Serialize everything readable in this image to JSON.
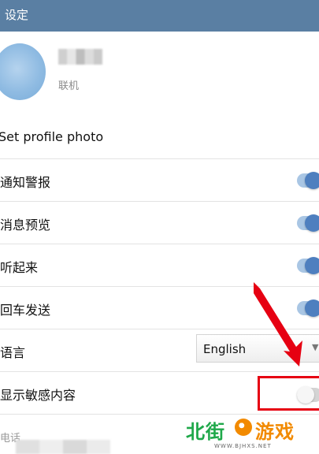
{
  "header": {
    "title": "设定"
  },
  "profile": {
    "status": "联机"
  },
  "set_photo": {
    "label": "Set profile photo"
  },
  "settings": [
    {
      "label": "通知警报",
      "toggle_on": true
    },
    {
      "label": "消息预览",
      "toggle_on": true
    },
    {
      "label": "听起来",
      "toggle_on": true
    },
    {
      "label": "回车发送",
      "toggle_on": true
    }
  ],
  "language": {
    "label": "语言",
    "value": "English"
  },
  "sensitive": {
    "label": "显示敏感内容",
    "toggle_on": false
  },
  "phone": {
    "label": "电话"
  },
  "watermark": {
    "text_green": "北街",
    "text_orange": "游戏",
    "url": "WWW.BJHXS.NET"
  },
  "colors": {
    "header": "#5a7fa3",
    "toggle_on": "#4e7fbf",
    "highlight": "#e60012"
  }
}
